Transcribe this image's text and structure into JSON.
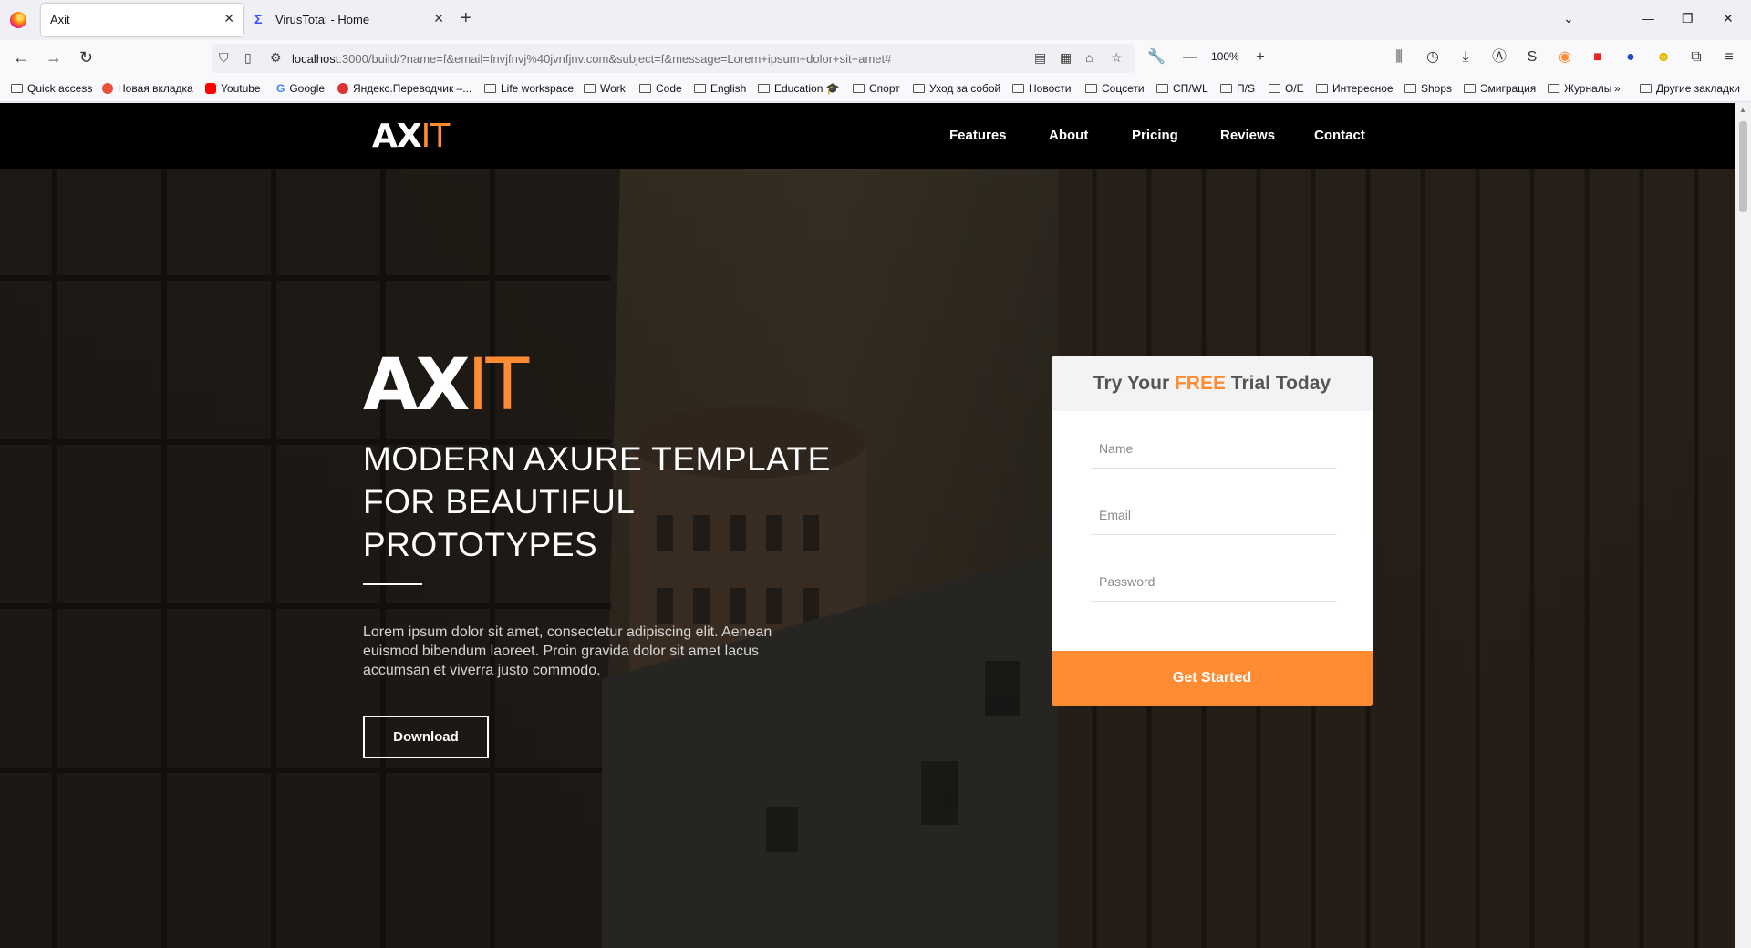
{
  "browser": {
    "tabs": [
      {
        "title": "Axit",
        "active": true
      },
      {
        "title": "VirusTotal - Home",
        "active": false
      }
    ],
    "url_host": "localhost",
    "url_rest": ":3000/build/?name=f&email=fnvjfnvj%40jvnfjnv.com&subject=f&message=Lorem+ipsum+dolor+sit+amet#",
    "zoom": "100%",
    "bookmarks": [
      {
        "label": "Quick access",
        "icon": "folder-icon"
      },
      {
        "label": "Новая вкладка",
        "icon": "firefox-icon"
      },
      {
        "label": "Youtube",
        "icon": "youtube-icon"
      },
      {
        "label": "Google",
        "icon": "google-icon"
      },
      {
        "label": "Яндекс.Переводчик –...",
        "icon": "yandex-icon"
      },
      {
        "label": "Life workspace",
        "icon": "folder-icon"
      },
      {
        "label": "Work",
        "icon": "folder-icon"
      },
      {
        "label": "Code",
        "icon": "folder-icon"
      },
      {
        "label": "English",
        "icon": "folder-icon"
      },
      {
        "label": "Education 🎓",
        "icon": "folder-icon"
      },
      {
        "label": "Спорт",
        "icon": "folder-icon"
      },
      {
        "label": "Уход за собой",
        "icon": "folder-icon"
      },
      {
        "label": "Новости",
        "icon": "folder-icon"
      },
      {
        "label": "Соцсети",
        "icon": "folder-icon"
      },
      {
        "label": "СП/WL",
        "icon": "folder-icon"
      },
      {
        "label": "П/S",
        "icon": "folder-icon"
      },
      {
        "label": "O/E",
        "icon": "folder-icon"
      },
      {
        "label": "Интересное",
        "icon": "folder-icon"
      },
      {
        "label": "Shops",
        "icon": "folder-icon"
      },
      {
        "label": "Эмиграция",
        "icon": "folder-icon"
      },
      {
        "label": "Журналы",
        "icon": "folder-icon"
      },
      {
        "label": "Другие закладки",
        "icon": "folder-icon"
      }
    ]
  },
  "site": {
    "logo_ax": "AX",
    "logo_it": "IT",
    "nav": [
      "Features",
      "About",
      "Pricing",
      "Reviews",
      "Contact"
    ],
    "hero": {
      "logo_ax": "AX",
      "logo_it": "IT",
      "title": "MODERN AXURE TEMPLATE FOR BEAUTIFUL PROTOTYPES",
      "text": "Lorem ipsum dolor sit amet, consectetur adipiscing elit. Aenean euismod bibendum laoreet. Proin gravida dolor sit amet lacus accumsan et viverra justo commodo.",
      "download_label": "Download"
    },
    "trial": {
      "title_pre": "Try Your ",
      "title_free": "FREE",
      "title_post": " Trial Today",
      "name_placeholder": "Name",
      "email_placeholder": "Email",
      "password_placeholder": "Password",
      "button_label": "Get Started"
    }
  },
  "colors": {
    "accent": "#ff8c33",
    "header_bg": "#000000"
  }
}
